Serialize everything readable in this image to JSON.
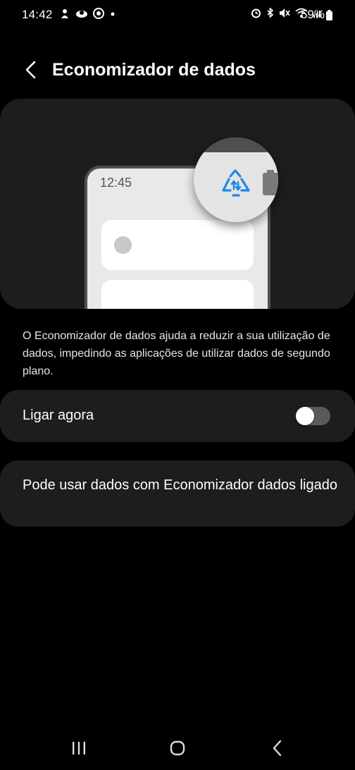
{
  "status_bar": {
    "time": "14:42",
    "battery_percent": "59%",
    "left_icons": [
      "notification-icon",
      "weather-icon",
      "chrome-icon",
      "dot-icon"
    ],
    "right_icons": [
      "alarm-icon",
      "bluetooth-icon",
      "mute-icon",
      "wifi-icon",
      "signal-icon",
      "battery-icon"
    ]
  },
  "header": {
    "title": "Economizador de dados",
    "back_icon": "chevron-left-icon"
  },
  "illustration": {
    "phone_time": "12:45",
    "accent_color": "#1e88e5"
  },
  "description": "O Economizador de dados ajuda a reduzir a sua utilização de dados, impedindo as aplicações de utilizar dados de segundo plano.",
  "settings": {
    "turn_on_label": "Ligar agora",
    "turn_on_enabled": false,
    "unrestricted_label": "Pode usar dados com Economizador dados ligado"
  },
  "nav_bar": {
    "recents_icon": "recents-icon",
    "home_icon": "home-icon",
    "back_icon": "back-icon"
  }
}
